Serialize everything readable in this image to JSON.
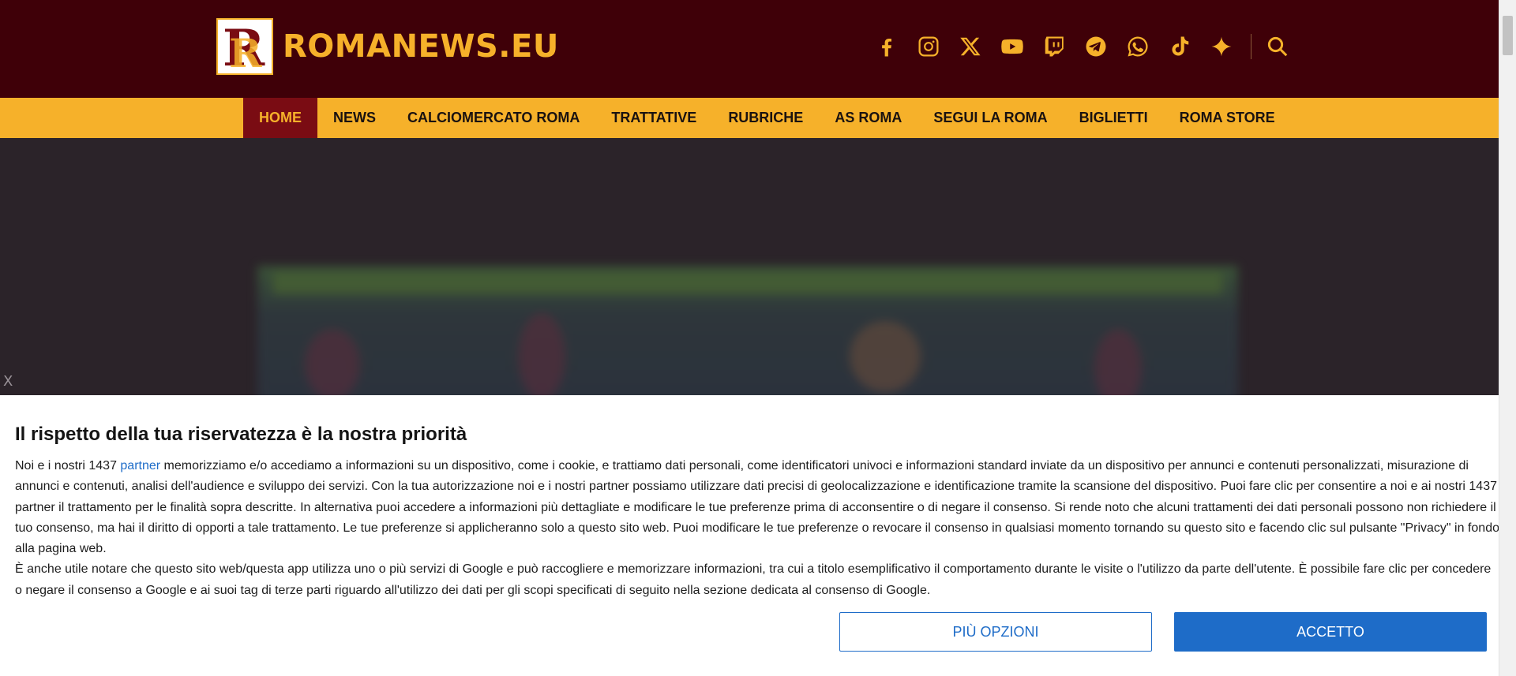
{
  "header": {
    "logo_text": "ROMANEWS.EU",
    "logo_letter": "R",
    "social_icons": [
      "facebook-icon",
      "instagram-icon",
      "x-icon",
      "youtube-icon",
      "twitch-icon",
      "telegram-icon",
      "whatsapp-icon",
      "tiktok-icon",
      "star-icon"
    ],
    "brand_color": "#3f0008",
    "accent_color": "#f6b12a"
  },
  "nav": {
    "items": [
      {
        "label": "HOME",
        "active": true
      },
      {
        "label": "NEWS"
      },
      {
        "label": "CALCIOMERCATO ROMA"
      },
      {
        "label": "TRATTATIVE"
      },
      {
        "label": "RUBRICHE"
      },
      {
        "label": "AS ROMA"
      },
      {
        "label": "SEGUI LA ROMA"
      },
      {
        "label": "BIGLIETTI"
      },
      {
        "label": "ROMA STORE"
      }
    ]
  },
  "overlay": {
    "close_label": "X"
  },
  "consent": {
    "title": "Il rispetto della tua riservatezza è la nostra priorità",
    "p1_before": "Noi e i nostri 1437 ",
    "p1_link": "partner",
    "p1_after": " memorizziamo e/o accediamo a informazioni su un dispositivo, come i cookie, e trattiamo dati personali, come identificatori univoci e informazioni standard inviate da un dispositivo per annunci e contenuti personalizzati, misurazione di annunci e contenuti, analisi dell'audience e sviluppo dei servizi. Con la tua autorizzazione noi e i nostri partner possiamo utilizzare dati precisi di geolocalizzazione e identificazione tramite la scansione del dispositivo. Puoi fare clic per consentire a noi e ai nostri 1437 partner il trattamento per le finalità sopra descritte. In alternativa puoi accedere a informazioni più dettagliate e modificare le tue preferenze prima di acconsentire o di negare il consenso. Si rende noto che alcuni trattamenti dei dati personali possono non richiedere il tuo consenso, ma hai il diritto di opporti a tale trattamento. Le tue preferenze si applicheranno solo a questo sito web. Puoi modificare le tue preferenze o revocare il consenso in qualsiasi momento tornando su questo sito e facendo clic sul pulsante \"Privacy\" in fondo alla pagina web.",
    "p2": "È anche utile notare che questo sito web/questa app utilizza uno o più servizi di Google e può raccogliere e memorizzare informazioni, tra cui a titolo esemplificativo il comportamento durante le visite o l'utilizzo da parte dell'utente. È possibile fare clic per concedere o negare il consenso a Google e ai suoi tag di terze parti riguardo all'utilizzo dei dati per gli scopi specificati di seguito nella sezione dedicata al consenso di Google.",
    "more_options_label": "PIÙ OPZIONI",
    "accept_label": "ACCETTO",
    "button_color": "#1e6cc8"
  }
}
